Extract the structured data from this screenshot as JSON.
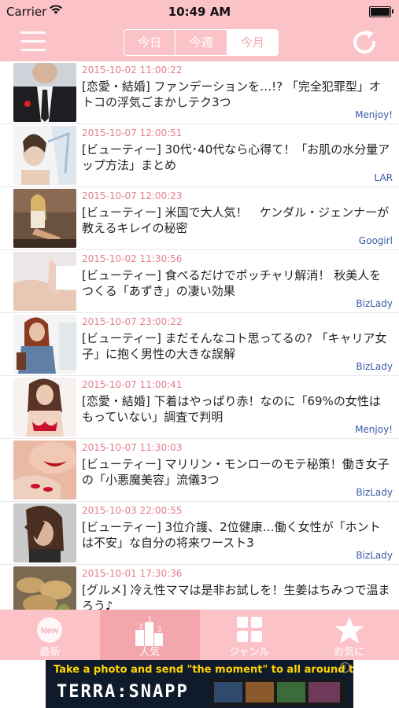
{
  "status": {
    "carrier": "Carrier",
    "time": "10:49 AM"
  },
  "nav": {
    "tabs": [
      "今日",
      "今週",
      "今月"
    ],
    "active_tab": "今月"
  },
  "articles": [
    {
      "date": "2015-10-02 11:00:22",
      "title": "[恋愛・結婚] ファンデーションを…!? 「完全犯罪型」オトコの浮気ごまかしテク3つ",
      "source": "Menjoy!"
    },
    {
      "date": "2015-10-07 12:00:51",
      "title": "[ビューティー] 30代･40代なら心得て！「お肌の水分量アップ方法」まとめ",
      "source": "LAR"
    },
    {
      "date": "2015-10-07 12:00:23",
      "title": "[ビューティー] 米国で大人気！　ケンダル・ジェンナーが教えるキレイの秘密",
      "source": "Googirl"
    },
    {
      "date": "2015-10-02 11:30:56",
      "title": "[ビューティー] 食べるだけでポッチャリ解消！ 秋美人をつくる「あずき」の凄い効果",
      "source": "BizLady"
    },
    {
      "date": "2015-10-07 23:00:22",
      "title": "[ビューティー] まだそんなコト思ってるの? 「キャリア女子」に抱く男性の大きな誤解",
      "source": "BizLady"
    },
    {
      "date": "2015-10-07 11:00:41",
      "title": "[恋愛・結婚] 下着はやっぱり赤！なのに「69%の女性はもっていない」調査で判明",
      "source": "Menjoy!"
    },
    {
      "date": "2015-10-07 11:30:03",
      "title": "[ビューティー] マリリン・モンローのモテ秘策！働き女子の「小悪魔美容」流儀3つ",
      "source": "BizLady"
    },
    {
      "date": "2015-10-03 22:00:55",
      "title": "[ビューティー] 3位介護、2位健康…働く女性が「ホントは不安」な自分の将来ワースト3",
      "source": "BizLady"
    },
    {
      "date": "2015-10-01 17:30:36",
      "title": "[グルメ] 冷え性ママは是非お試しを！生姜はちみつで温まろう♪",
      "source": ""
    }
  ],
  "tabbar": {
    "items": [
      "最新",
      "人気",
      "ジャンル",
      "お気に"
    ],
    "active": "人気",
    "new_badge": "New"
  },
  "ad": {
    "headline": "Take a photo and send  \"the moment\" to all around the world!",
    "brand": "TERRA:SNAPP",
    "info": "i"
  },
  "colors": {
    "header": "#fbc3c8",
    "date": "#e47f8c",
    "source": "#3b5aa8"
  }
}
